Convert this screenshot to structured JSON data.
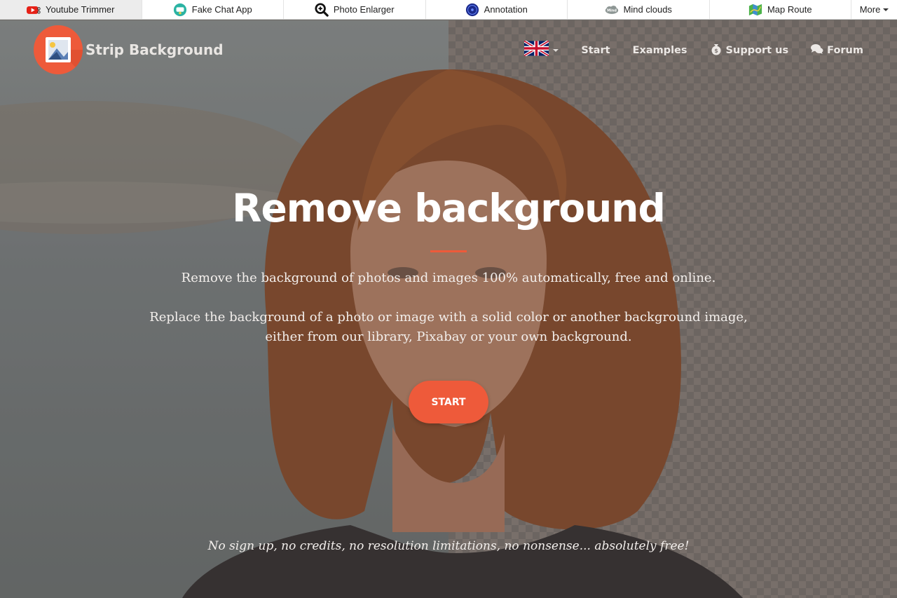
{
  "topbar": {
    "tools": [
      {
        "label": "Youtube Trimmer",
        "icon": "youtube-icon"
      },
      {
        "label": "Fake Chat App",
        "icon": "chat-app-icon"
      },
      {
        "label": "Photo Enlarger",
        "icon": "magnifier-icon"
      },
      {
        "label": "Annotation",
        "icon": "annotation-icon"
      },
      {
        "label": "Mind clouds",
        "icon": "mind-cloud-icon"
      },
      {
        "label": "Map Route",
        "icon": "map-icon"
      }
    ],
    "more_label": "More"
  },
  "navbar": {
    "brand": "Strip Background",
    "language_icon": "uk-flag-icon",
    "links": [
      {
        "label": "Start"
      },
      {
        "label": "Examples"
      },
      {
        "label": "Support us",
        "icon": "money-bag-icon"
      },
      {
        "label": "Forum",
        "icon": "chat-bubbles-icon"
      }
    ]
  },
  "hero": {
    "title": "Remove background",
    "subtitle_1": "Remove the background of photos and images 100% automatically, free and online.",
    "subtitle_2": "Replace the background of a photo or image with a solid color or another background image, either from our library, Pixabay or your own background.",
    "cta_label": "START",
    "note": "No sign up, no credits, no resolution limitations, no nonsense... absolutely free!"
  },
  "colors": {
    "accent": "#ee5a3a",
    "text_light": "#f3efec"
  }
}
